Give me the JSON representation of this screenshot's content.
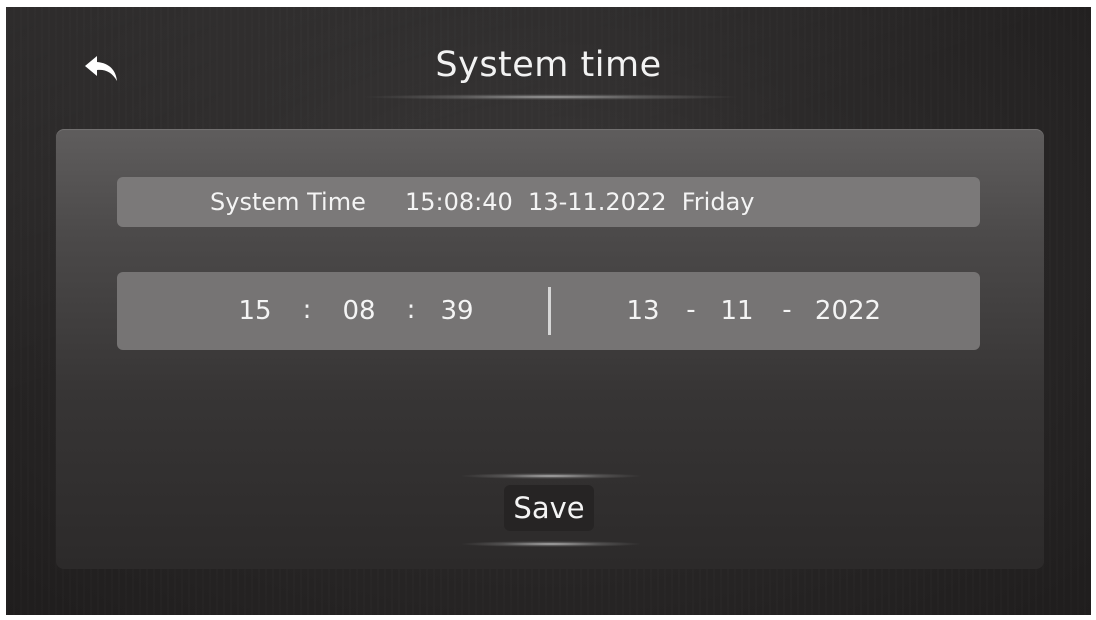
{
  "header": {
    "title": "System time",
    "back_icon": "back-arrow-icon"
  },
  "system_time": {
    "label": "System Time",
    "value": "15:08:40  13-11.2022  Friday"
  },
  "editor": {
    "hour": "15",
    "minute": "08",
    "second": "39",
    "time_separator": ":",
    "day": "13",
    "month": "11",
    "year": "2022",
    "date_separator": "-"
  },
  "actions": {
    "save_label": "Save"
  },
  "colors": {
    "background": "#2b2929",
    "panel": "#4b4949",
    "row": "#7b7979",
    "text": "#f4f4f4"
  }
}
